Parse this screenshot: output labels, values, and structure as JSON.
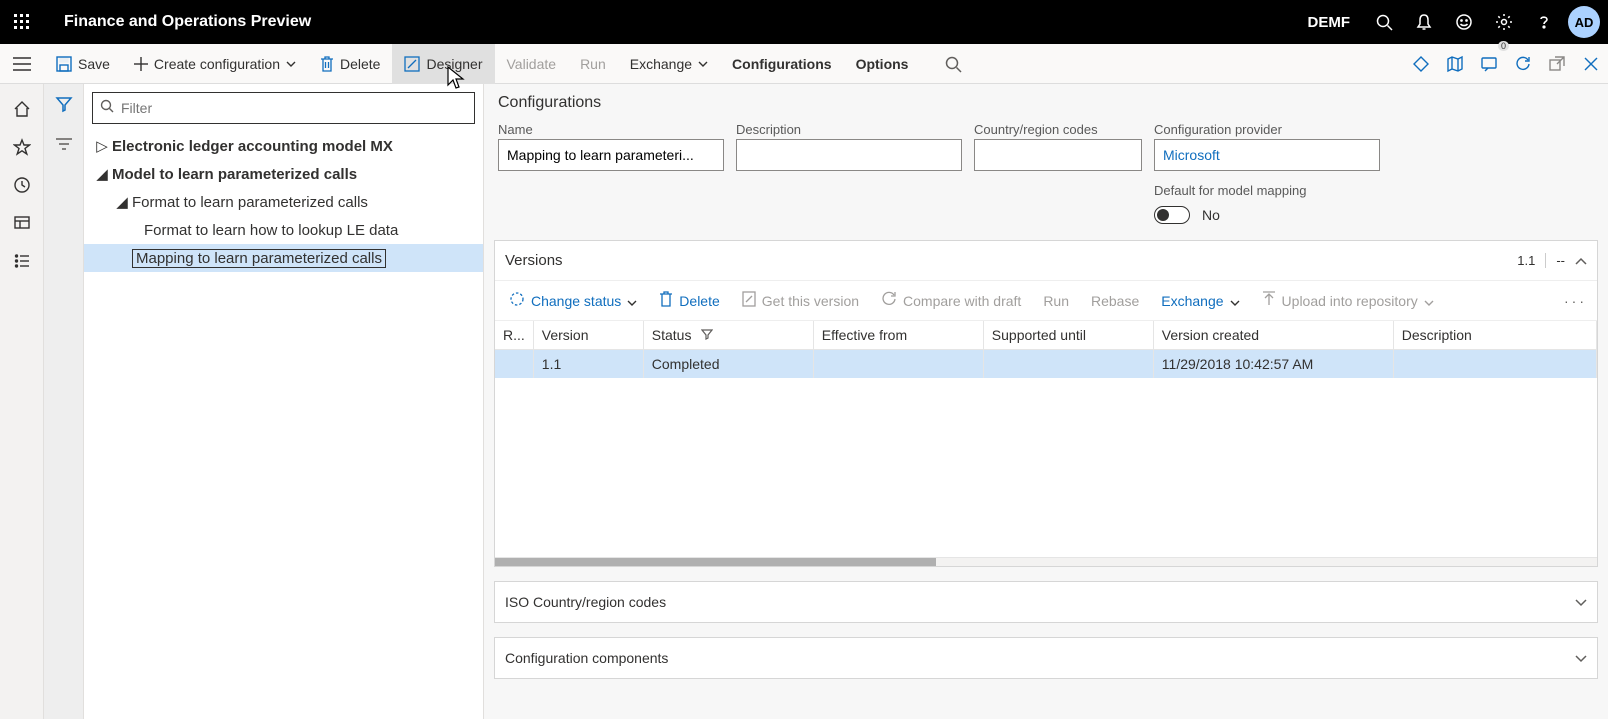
{
  "header": {
    "app_title": "Finance and Operations Preview",
    "company": "DEMF",
    "avatar": "AD"
  },
  "cmdbar": {
    "save": "Save",
    "create_config": "Create configuration",
    "delete": "Delete",
    "designer": "Designer",
    "validate": "Validate",
    "run": "Run",
    "exchange": "Exchange",
    "configurations": "Configurations",
    "options": "Options"
  },
  "tree": {
    "filter_placeholder": "Filter",
    "items": [
      {
        "label": "Electronic ledger accounting model MX",
        "indent": 0,
        "expanded": false,
        "bold": true
      },
      {
        "label": "Model to learn parameterized calls",
        "indent": 0,
        "expanded": true,
        "bold": true
      },
      {
        "label": "Format to learn parameterized calls",
        "indent": 1,
        "expanded": true,
        "bold": false
      },
      {
        "label": "Format to learn how to lookup LE data",
        "indent": 2,
        "expanded": null,
        "bold": false
      },
      {
        "label": "Mapping to learn parameterized calls",
        "indent": 2,
        "expanded": null,
        "bold": false,
        "selected": true
      }
    ]
  },
  "configurations": {
    "heading": "Configurations",
    "name_label": "Name",
    "name_value": "Mapping to learn parameteri...",
    "description_label": "Description",
    "description_value": "",
    "country_codes_label": "Country/region codes",
    "country_codes_value": "",
    "provider_label": "Configuration provider",
    "provider_value": "Microsoft",
    "default_label": "Default for model mapping",
    "default_value_text": "No"
  },
  "versions": {
    "title": "Versions",
    "summary_version": "1.1",
    "summary_dash": "--",
    "toolbar": {
      "change_status": "Change status",
      "delete": "Delete",
      "get_this_version": "Get this version",
      "compare_draft": "Compare with draft",
      "run": "Run",
      "rebase": "Rebase",
      "exchange": "Exchange",
      "upload_repo": "Upload into repository"
    },
    "columns": {
      "r": "R...",
      "version": "Version",
      "status": "Status",
      "effective_from": "Effective from",
      "supported_until": "Supported until",
      "version_created": "Version created",
      "description": "Description"
    },
    "rows": [
      {
        "version": "1.1",
        "status": "Completed",
        "effective_from": "",
        "supported_until": "",
        "version_created": "11/29/2018 10:42:57 AM",
        "description": ""
      }
    ]
  },
  "iso_section": {
    "title": "ISO Country/region codes"
  },
  "components_section": {
    "title": "Configuration components"
  },
  "right_cmd_icons": {
    "msg_count": "0"
  },
  "icons": {
    "chevron": "⌄",
    "up_chevron": "⌃",
    "ellipsis": "···"
  }
}
